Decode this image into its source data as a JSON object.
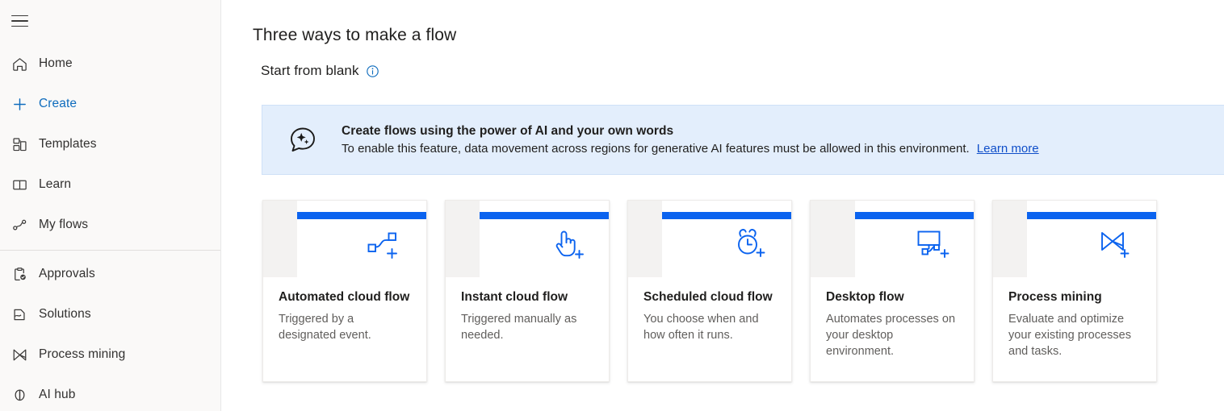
{
  "sidebar": {
    "menu_button": "hamburger-menu",
    "items": [
      {
        "label": "Home",
        "icon": "home-icon",
        "active": false,
        "divider_after": false
      },
      {
        "label": "Create",
        "icon": "plus-icon",
        "active": true,
        "divider_after": false
      },
      {
        "label": "Templates",
        "icon": "templates-icon",
        "active": false,
        "divider_after": false
      },
      {
        "label": "Learn",
        "icon": "book-icon",
        "active": false,
        "divider_after": false
      },
      {
        "label": "My flows",
        "icon": "flow-icon",
        "active": false,
        "divider_after": true
      },
      {
        "label": "Approvals",
        "icon": "approvals-icon",
        "active": false,
        "divider_after": false
      },
      {
        "label": "Solutions",
        "icon": "solutions-icon",
        "active": false,
        "divider_after": false
      },
      {
        "label": "Process mining",
        "icon": "process-mining-icon",
        "active": false,
        "divider_after": false
      },
      {
        "label": "AI hub",
        "icon": "ai-hub-icon",
        "active": false,
        "divider_after": false
      }
    ]
  },
  "main": {
    "page_title": "Three ways to make a flow",
    "section_title": "Start from blank",
    "info_icon": "info-circle-icon"
  },
  "banner": {
    "icon": "ai-sparkle-bubble-icon",
    "title": "Create flows using the power of AI and your own words",
    "subtitle": "To enable this feature, data movement across regions for generative AI features must be allowed in this environment.",
    "link_label": "Learn more",
    "background_color": "#e3eefc",
    "link_color": "#0f4ec9"
  },
  "cards": {
    "accent_color": "#0b63ef",
    "items": [
      {
        "title": "Automated cloud flow",
        "description": "Triggered by a designated event.",
        "icon": "automated-flow-icon",
        "art_gutter": 42
      },
      {
        "title": "Instant cloud flow",
        "description": "Triggered manually as needed.",
        "icon": "instant-tap-icon",
        "art_gutter": 42
      },
      {
        "title": "Scheduled cloud flow",
        "description": "You choose when and how often it runs.",
        "icon": "alarm-clock-icon",
        "art_gutter": 42
      },
      {
        "title": "Desktop flow",
        "description": "Automates processes on your desktop environment.",
        "icon": "desktop-flow-icon",
        "art_gutter": 55
      },
      {
        "title": "Process mining",
        "description": "Evaluate and optimize your existing processes and tasks.",
        "icon": "process-mining-bowtie-icon",
        "art_gutter": 42
      }
    ]
  }
}
